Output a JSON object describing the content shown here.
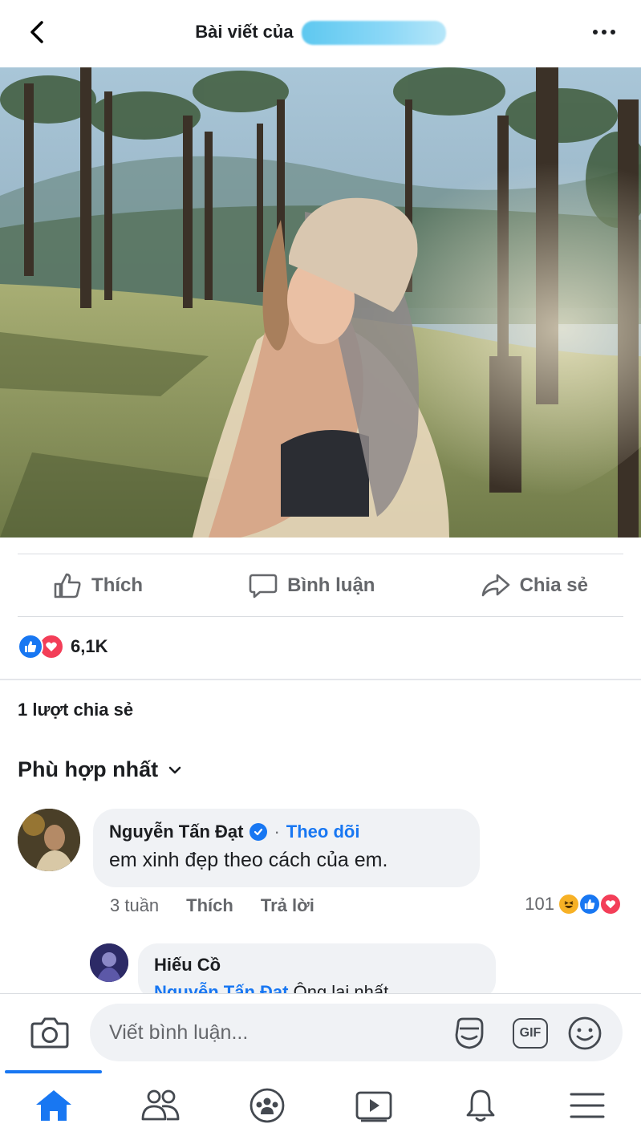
{
  "header": {
    "title": "Bài viết của",
    "back_icon": "chevron-left-icon",
    "more_icon": "more-horizontal-icon"
  },
  "post": {
    "actions": {
      "like": "Thích",
      "comment": "Bình luận",
      "share": "Chia sẻ"
    },
    "reactions": {
      "count": "6,1K",
      "types": [
        "like",
        "love"
      ]
    },
    "shares_text": "1 lượt chia sẻ"
  },
  "comments": {
    "sort_label": "Phù hợp nhất",
    "items": [
      {
        "author": "Nguyễn Tấn Đạt",
        "verified": true,
        "follow_label": "Theo dõi",
        "text": "em xinh đẹp theo cách của em.",
        "time": "3 tuần",
        "like_label": "Thích",
        "reply_label": "Trả lời",
        "reaction_count": "101",
        "reaction_types": [
          "haha",
          "like",
          "love"
        ]
      }
    ],
    "reply": {
      "author": "Hiếu Cồ",
      "tag": "Nguyễn Tấn Đạt",
      "text": "Ông lại nhất"
    }
  },
  "composer": {
    "placeholder": "Viết bình luận...",
    "gif_label": "GIF"
  },
  "nav": {
    "items": [
      "home",
      "friends",
      "groups",
      "watch",
      "notifications",
      "menu"
    ],
    "active": "home"
  },
  "colors": {
    "accent": "#1877f2",
    "love": "#f33e58",
    "haha": "#f7b125",
    "muted": "#65676b",
    "bubble": "#f0f2f5"
  }
}
